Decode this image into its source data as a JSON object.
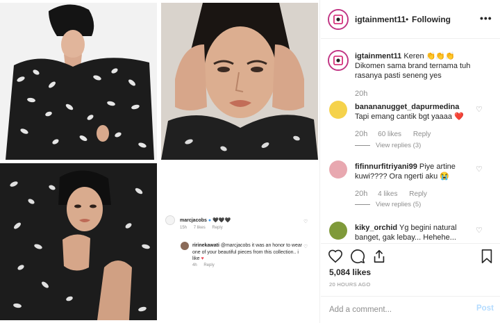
{
  "post": {
    "author": "igtainment11",
    "separator": "•",
    "follow_status": "Following",
    "more_label": "•••"
  },
  "media_overlay": {
    "comment1": {
      "user": "marcjacobs",
      "text": "🖤🖤🖤",
      "time": "15h",
      "likes": "7 likes",
      "reply": "Reply"
    },
    "comment2": {
      "user": "ririnekawati",
      "text": "@marcjacobs it was an honor to wear one of your beautiful pieces from this collection.. i like",
      "time": "4h",
      "reply": "Reply"
    }
  },
  "caption": {
    "user": "igtainment11",
    "text": "Keren 👏👏👏",
    "text2": "Dikomen sama brand ternama tuh rasanya pasti seneng yes",
    "time": "20h"
  },
  "comments": [
    {
      "user": "banananugget_dapurmedina",
      "text": "Tapi emang cantik bgt yaaaa",
      "emoji": "❤️",
      "time": "20h",
      "likes": "60 likes",
      "reply": "Reply",
      "view_replies": "View replies (3)"
    },
    {
      "user": "fifinnurfitriyani99",
      "text": "Piye artine kuwi???? Ora ngerti aku",
      "emoji": "😭",
      "time": "20h",
      "likes": "4 likes",
      "reply": "Reply",
      "view_replies": "View replies (5)"
    },
    {
      "user": "kiky_orchid",
      "text": "Yg begini natural banget, gak lebay... Hehehe...",
      "emoji": "",
      "time": "",
      "likes": "",
      "reply": "",
      "view_replies": ""
    }
  ],
  "actions": {
    "likes": "5,084 likes",
    "time_ago": "20 HOURS AGO"
  },
  "add_comment": {
    "placeholder": "Add a comment...",
    "post_label": "Post"
  },
  "colors": {
    "accent": "#0095f6",
    "post_disabled": "#b3dbff",
    "muted": "#8e8e8e",
    "heart_red": "#ed4956"
  }
}
